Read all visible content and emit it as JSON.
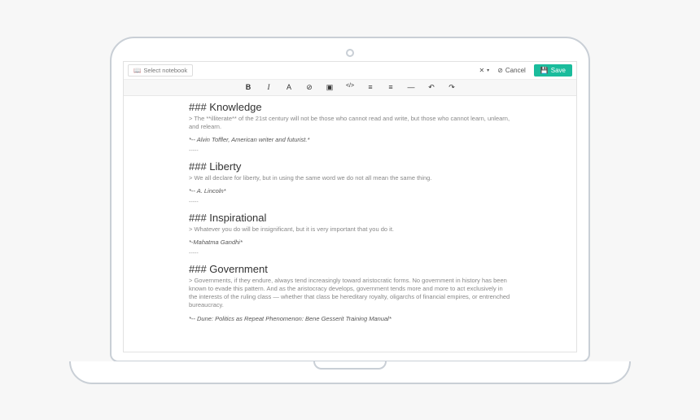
{
  "topbar": {
    "notebook_placeholder": "Select notebook",
    "fullscreen_label": "",
    "cancel_label": "Cancel",
    "save_label": "Save"
  },
  "toolbar": {
    "bold": "B",
    "italic": "I",
    "font": "A",
    "link": "⊘",
    "image": "▣",
    "code": "</>",
    "list_ol": "≡",
    "list_ul": "≡",
    "hr": "—",
    "undo": "↶",
    "redo": "↷"
  },
  "doc": {
    "sections": [
      {
        "heading": "### Knowledge",
        "quote": "> The **illiterate** of the 21st century will not be those who cannot read and write, but those who cannot learn, unlearn, and relearn.",
        "attribution": "*-- Alvin Toffler, American writer and futurist.*",
        "divider": "-----"
      },
      {
        "heading": "### Liberty",
        "quote": "> We all declare for liberty, but in using the same word we do not all mean the same thing.",
        "attribution": "*-- A. Lincoln*",
        "divider": "-----"
      },
      {
        "heading": "### Inspirational",
        "quote": "> Whatever you do will be insignificant, but it is very important that you do it.",
        "attribution": "*-Mahatma Gandhi*",
        "divider": "-----"
      },
      {
        "heading": "### Government",
        "quote": "> Governments, if they endure, always tend increasingly toward aristocratic forms. No government in history has been known to evade this pattern. And as the aristocracy develops, government tends more and more to act exclusively in the interests of the ruling class — whether that class be hereditary royalty, oligarchs of financial empires, or entrenched bureaucracy.",
        "attribution": "*-- Dune: Politics as Repeat Phenomenon: Bene Gesserit Training Manual*",
        "divider": ""
      }
    ]
  }
}
